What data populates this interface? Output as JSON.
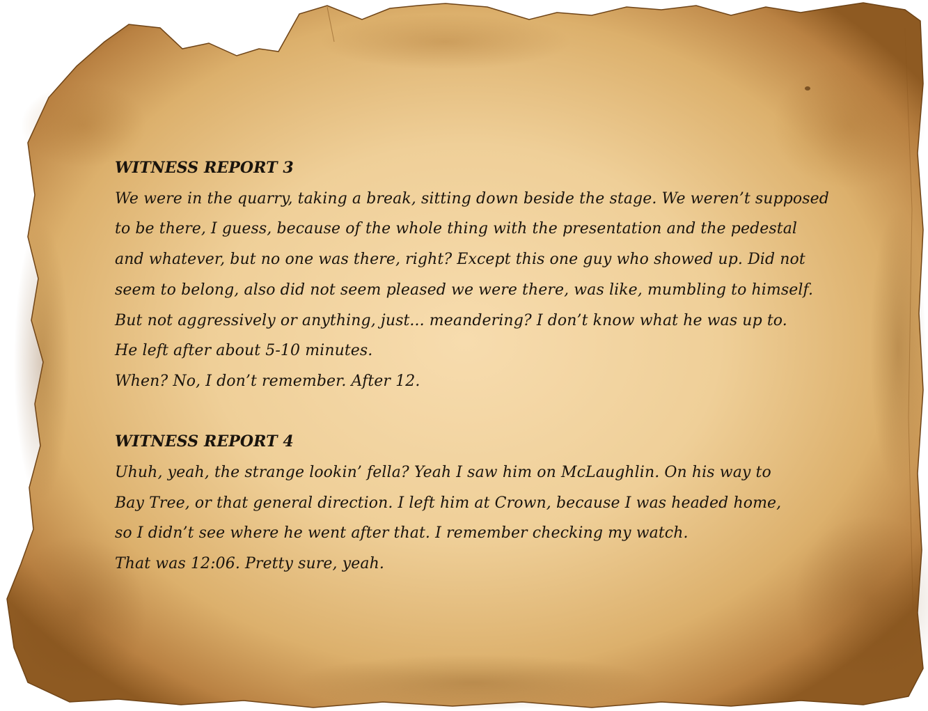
{
  "reports": [
    {
      "title": "WITNESS REPORT 3",
      "lines": [
        "We were in the quarry, taking a break, sitting down beside the stage. We weren’t supposed",
        "to be there, I guess, because of the whole thing with the presentation and the pedestal",
        "and whatever, but no one was there, right? Except this one guy who showed up. Did not",
        "seem to belong, also did not seem pleased we were there, was like, mumbling to himself.",
        "But not aggressively or anything, just... meandering? I don’t know what he was up to.",
        "He left after about 5-10 minutes.",
        "When? No, I don’t remember. After 12."
      ]
    },
    {
      "title": "WITNESS REPORT 4",
      "lines": [
        "Uhuh, yeah, the strange lookin’ fella? Yeah I saw him on McLaughlin. On his way to",
        "Bay Tree, or that general direction. I left him at Crown, because I was headed home,",
        "so I didn’t see where he went after that. I remember checking my watch.",
        "That was 12:06. Pretty sure, yeah."
      ]
    }
  ],
  "colors": {
    "paper_center": "#f6d9a8",
    "paper_edge": "#a06a2c",
    "text": "#1a140d"
  }
}
